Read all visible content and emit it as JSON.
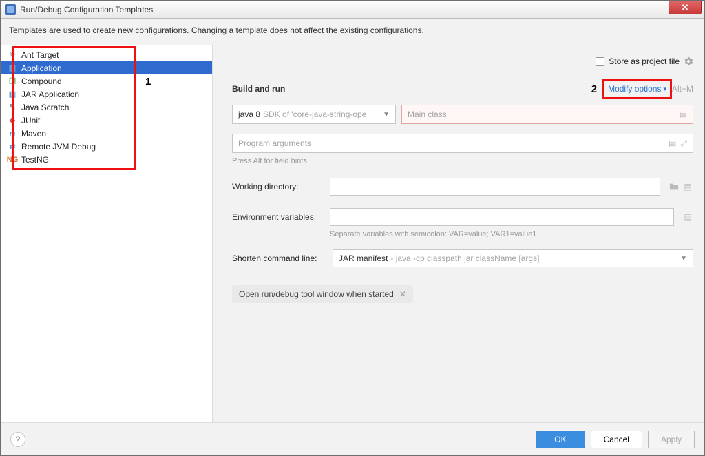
{
  "window": {
    "title": "Run/Debug Configuration Templates",
    "description": "Templates are used to create new configurations. Changing a template does not affect the existing configurations."
  },
  "sidebar": {
    "items": [
      {
        "label": "Ant Target",
        "icon": "ant"
      },
      {
        "label": "Application",
        "icon": "app",
        "selected": true
      },
      {
        "label": "Compound",
        "icon": "comp"
      },
      {
        "label": "JAR Application",
        "icon": "jar"
      },
      {
        "label": "Java Scratch",
        "icon": "scr"
      },
      {
        "label": "JUnit",
        "icon": "junit"
      },
      {
        "label": "Maven",
        "icon": "maven"
      },
      {
        "label": "Remote JVM Debug",
        "icon": "remote"
      },
      {
        "label": "TestNG",
        "icon": "testng"
      }
    ]
  },
  "markers": {
    "one": "1",
    "two": "2"
  },
  "right": {
    "store_as_project_file": "Store as project file",
    "section": "Build and run",
    "modify_options": "Modify options",
    "modify_shortcut": "Alt+M",
    "sdk": {
      "label": "java 8",
      "desc": "SDK of 'core-java-string-ope"
    },
    "main_class_placeholder": "Main class",
    "program_args_placeholder": "Program arguments",
    "hint": "Press Alt for field hints",
    "working_dir_label": "Working directory:",
    "env_vars_label": "Environment variables:",
    "env_hint": "Separate variables with semicolon: VAR=value; VAR1=value1",
    "shorten_label": "Shorten command line:",
    "shorten_value": "JAR manifest",
    "shorten_desc": "- java -cp classpath.jar className [args]",
    "chip": "Open run/debug tool window when started"
  },
  "footer": {
    "ok": "OK",
    "cancel": "Cancel",
    "apply": "Apply"
  },
  "icons": {
    "ant": "✳",
    "app": "▦",
    "comp": "❏",
    "jar": "▥",
    "scr": "✎",
    "junit": "◆",
    "maven": "m",
    "remote": "⇄",
    "testng": "NG"
  }
}
